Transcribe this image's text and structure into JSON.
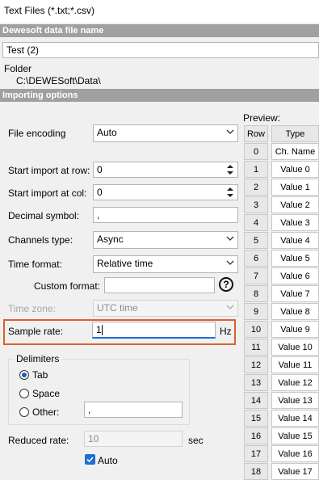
{
  "window": {
    "title": "Text Files (*.txt;*.csv)"
  },
  "file_section": {
    "header": "Dewesoft data file name",
    "file_name": "Test (2)",
    "folder_label": "Folder",
    "folder_path": "C:\\DEWESoft\\Data\\"
  },
  "import_section": {
    "header": "Importing options",
    "file_encoding": {
      "label": "File encoding",
      "value": "Auto"
    },
    "start_row": {
      "label": "Start import at row:",
      "value": "0"
    },
    "start_col": {
      "label": "Start import at col:",
      "value": "0"
    },
    "decimal_symbol": {
      "label": "Decimal symbol:",
      "value": ","
    },
    "channels_type": {
      "label": "Channels type:",
      "value": "Async"
    },
    "time_format": {
      "label": "Time format:",
      "value": "Relative time"
    },
    "custom_format": {
      "label": "Custom format:",
      "value": "",
      "help": "?"
    },
    "time_zone": {
      "label": "Time zone:",
      "value": "UTC time"
    },
    "sample_rate": {
      "label": "Sample rate:",
      "value": "1",
      "unit": "Hz"
    },
    "delimiters": {
      "title": "Delimiters",
      "options": [
        "Tab",
        "Space",
        "Other:"
      ],
      "selected": "Tab",
      "other_value": ","
    },
    "reduced_rate": {
      "label": "Reduced rate:",
      "value": "10",
      "unit": "sec"
    },
    "auto": {
      "label": "Auto",
      "checked": true
    }
  },
  "preview": {
    "label": "Preview:",
    "headers": [
      "Row",
      "Type"
    ],
    "rows": [
      [
        "0",
        "Ch. Name"
      ],
      [
        "1",
        "Value 0"
      ],
      [
        "2",
        "Value 1"
      ],
      [
        "3",
        "Value 2"
      ],
      [
        "4",
        "Value 3"
      ],
      [
        "5",
        "Value 4"
      ],
      [
        "6",
        "Value 5"
      ],
      [
        "7",
        "Value 6"
      ],
      [
        "8",
        "Value 7"
      ],
      [
        "9",
        "Value 8"
      ],
      [
        "10",
        "Value 9"
      ],
      [
        "11",
        "Value 10"
      ],
      [
        "12",
        "Value 11"
      ],
      [
        "13",
        "Value 12"
      ],
      [
        "14",
        "Value 13"
      ],
      [
        "15",
        "Value 14"
      ],
      [
        "16",
        "Value 15"
      ],
      [
        "17",
        "Value 16"
      ],
      [
        "18",
        "Value 17"
      ]
    ]
  },
  "colors": {
    "highlight": "#d9622b",
    "accent": "#1f6ed4",
    "section_header": "#a0a0a0"
  }
}
